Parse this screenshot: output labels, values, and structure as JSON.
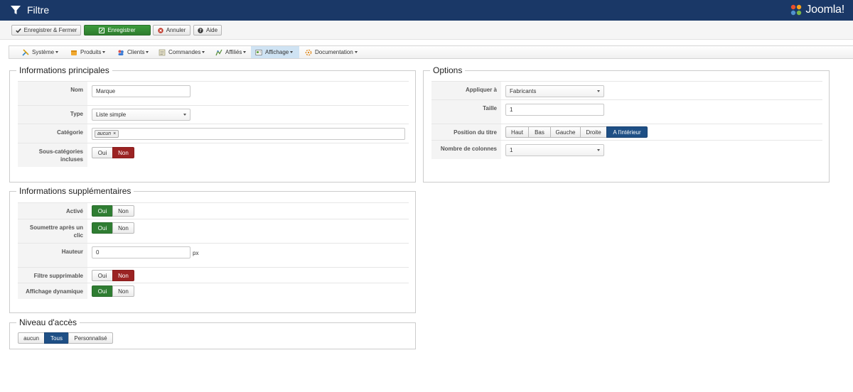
{
  "header": {
    "title": "Filtre",
    "logo_text": "Joomla!"
  },
  "toolbar": {
    "save_close": "Enregistrer & Fermer",
    "save": "Enregistrer",
    "cancel": "Annuler",
    "help": "Aide"
  },
  "menu": {
    "items": [
      {
        "label": "Système",
        "icon": "tools-icon"
      },
      {
        "label": "Produits",
        "icon": "products-icon"
      },
      {
        "label": "Clients",
        "icon": "customers-icon"
      },
      {
        "label": "Commandes",
        "icon": "orders-icon"
      },
      {
        "label": "Affiliés",
        "icon": "affiliates-icon"
      },
      {
        "label": "Affichage",
        "icon": "display-icon"
      },
      {
        "label": "Documentation",
        "icon": "documentation-icon"
      }
    ],
    "active": "Affichage"
  },
  "main_info": {
    "legend": "Informations principales",
    "name_label": "Nom",
    "name_value": "Marque",
    "type_label": "Type",
    "type_value": "Liste simple",
    "category_label": "Catégorie",
    "category_tag": "aucun",
    "category_tag_remove": "×",
    "subcat_label": "Sous-catégories incluses",
    "subcat_yes": "Oui",
    "subcat_no": "Non",
    "subcat_selected": "Non"
  },
  "extra_info": {
    "legend": "Informations supplémentaires",
    "active_label": "Activé",
    "active_yes": "Oui",
    "active_no": "Non",
    "active_selected": "Oui",
    "submit_label": "Soumettre après un clic",
    "submit_yes": "Oui",
    "submit_no": "Non",
    "submit_selected": "Oui",
    "height_label": "Hauteur",
    "height_value": "0",
    "height_unit": "px",
    "removable_label": "Filtre supprimable",
    "removable_yes": "Oui",
    "removable_no": "Non",
    "removable_selected": "Non",
    "dynamic_label": "Affichage dynamique",
    "dynamic_yes": "Oui",
    "dynamic_no": "Non",
    "dynamic_selected": "Oui"
  },
  "access": {
    "legend": "Niveau d'accès",
    "options": [
      "aucun",
      "Tous",
      "Personnalisé"
    ],
    "selected": "Tous"
  },
  "options": {
    "legend": "Options",
    "apply_label": "Appliquer à",
    "apply_value": "Fabricants",
    "size_label": "Taille",
    "size_value": "1",
    "title_pos_label": "Position du titre",
    "title_pos_options": [
      "Haut",
      "Bas",
      "Gauche",
      "Droite",
      "A l'intérieur"
    ],
    "title_pos_selected": "A l'intérieur",
    "columns_label": "Nombre de colonnes",
    "columns_value": "1"
  },
  "colors": {
    "header_bg": "#1a3867",
    "save_green": "#2e7d2e",
    "toggle_red": "#9b2323",
    "toggle_green": "#2f7d32",
    "toggle_blue": "#1e4f85",
    "menu_active": "#cfe3f3"
  }
}
